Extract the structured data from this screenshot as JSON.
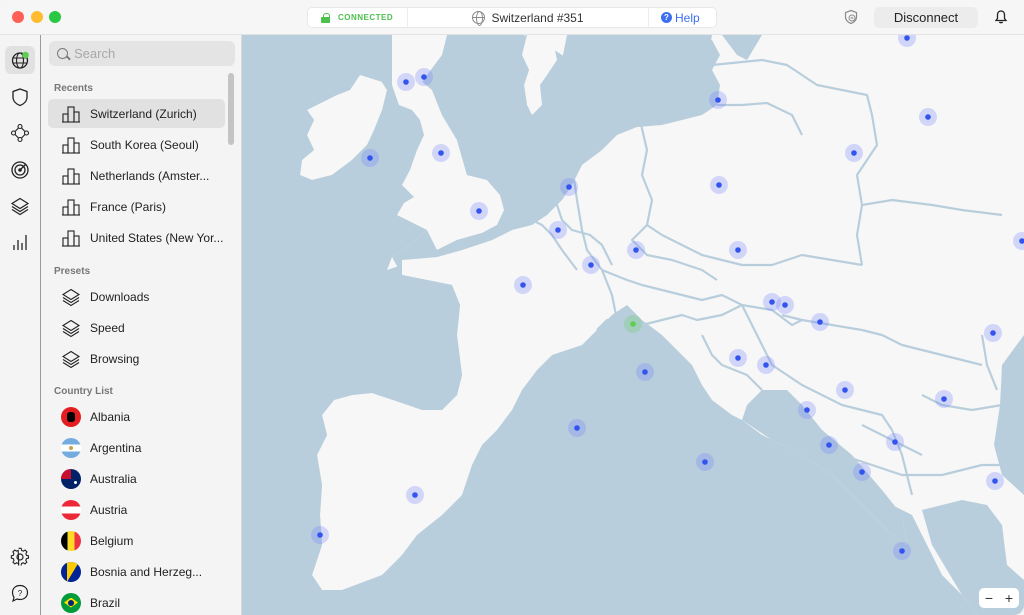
{
  "titlebar": {
    "status": "CONNECTED",
    "server": "Switzerland #351",
    "help": "Help",
    "disconnect": "Disconnect"
  },
  "rail": {
    "items": [
      "globe",
      "shield",
      "meshnet",
      "threat-protection",
      "presets",
      "stats"
    ],
    "bottom": [
      "settings",
      "support"
    ]
  },
  "sidebar": {
    "search_placeholder": "Search",
    "recents_title": "Recents",
    "recents": [
      {
        "label": "Switzerland (Zurich)"
      },
      {
        "label": "South Korea (Seoul)"
      },
      {
        "label": "Netherlands (Amster..."
      },
      {
        "label": "France (Paris)"
      },
      {
        "label": "United States (New Yor..."
      }
    ],
    "presets_title": "Presets",
    "presets": [
      {
        "label": "Downloads"
      },
      {
        "label": "Speed"
      },
      {
        "label": "Browsing"
      }
    ],
    "countries_title": "Country List",
    "countries": [
      {
        "label": "Albania"
      },
      {
        "label": "Argentina"
      },
      {
        "label": "Australia"
      },
      {
        "label": "Austria"
      },
      {
        "label": "Belgium"
      },
      {
        "label": "Bosnia and Herzeg..."
      },
      {
        "label": "Brazil"
      }
    ]
  },
  "map": {
    "colors": {
      "sea": "#b9cedc",
      "land": "#f7f7f7",
      "border": "#b9cedc",
      "server": "#3355ee",
      "connected": "#5ccf52"
    },
    "zoom_out": "−",
    "zoom_in": "+"
  }
}
